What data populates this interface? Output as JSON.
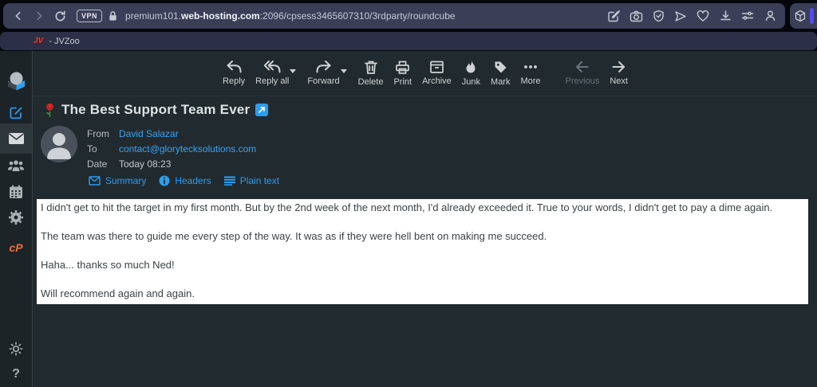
{
  "browser": {
    "vpn_badge": "VPN",
    "url_prefix": "premium101.",
    "url_domain": "web-hosting.com",
    "url_suffix": ":2096/cpsess3465607310/3rdparty/roundcube",
    "tab": {
      "favicon_text": "JV",
      "title": "- JVZoo"
    }
  },
  "sidebar": {
    "cpanel_label": "cP",
    "help_label": "?"
  },
  "toolbar": {
    "items": [
      {
        "label": "Reply"
      },
      {
        "label": "Reply all"
      },
      {
        "label": "Forward"
      },
      {
        "label": "Delete"
      },
      {
        "label": "Print"
      },
      {
        "label": "Archive"
      },
      {
        "label": "Junk"
      },
      {
        "label": "Mark"
      },
      {
        "label": "More"
      },
      {
        "label": "Previous"
      },
      {
        "label": "Next"
      }
    ]
  },
  "message": {
    "subject": "The Best Support Team Ever",
    "subject_emoji": "🌹",
    "headers": {
      "from_label": "From",
      "from_value": "David Salazar",
      "to_label": "To",
      "to_value": "contact@glorytecksolutions.com",
      "date_label": "Date",
      "date_value": "Today 08:23"
    },
    "tabs": [
      {
        "label": "Summary"
      },
      {
        "label": "Headers"
      },
      {
        "label": "Plain text"
      }
    ],
    "body": [
      "I didn't get to hit the target in my first month. But by the 2nd week of the next month, I'd already exceeded it. True to your words, I didn't get to pay a dime again.",
      "The team was there to guide me every step of the way. It was as if they were hell bent on making me succeed.",
      "Haha... thanks so much Ned!",
      "Will recommend again and again."
    ]
  },
  "colors": {
    "accent_blue": "#2e9df0",
    "link_blue": "#3ba2f2",
    "cpanel_orange": "#ff6c2c",
    "extension_purple": "#5a49f0",
    "jvzoo_red": "#e03c31"
  }
}
